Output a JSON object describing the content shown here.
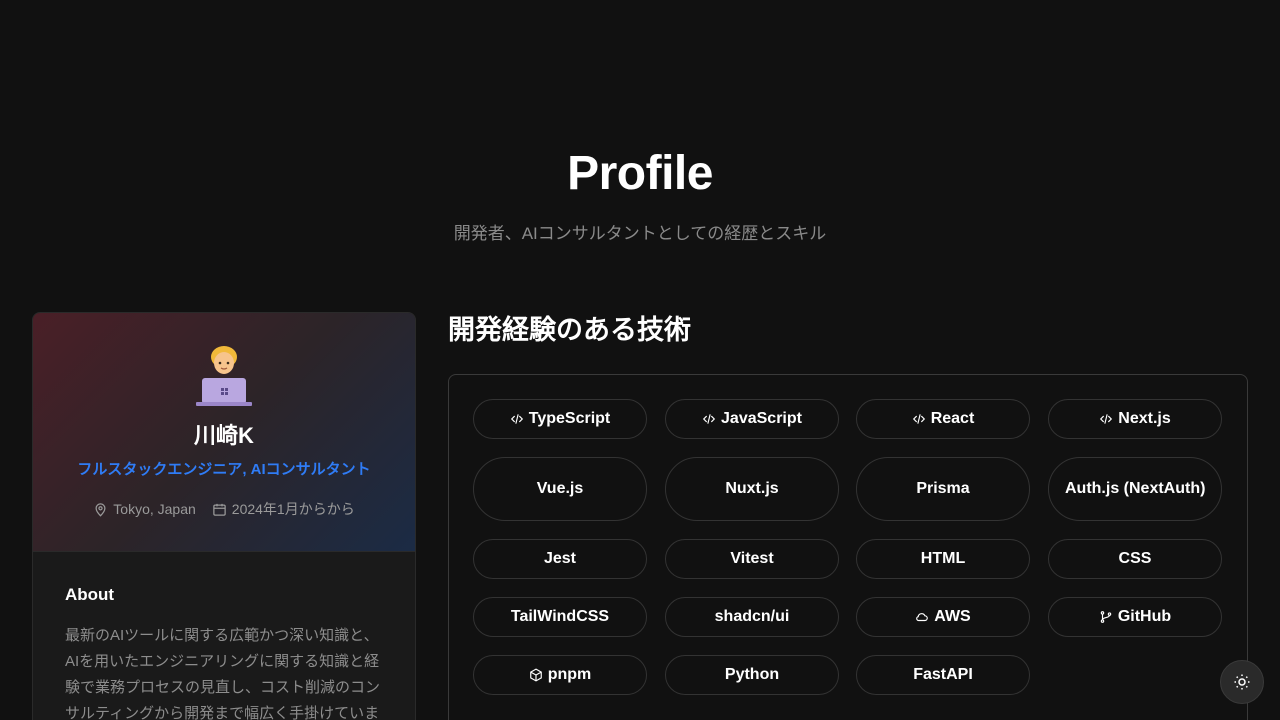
{
  "hero": {
    "title": "Profile",
    "subtitle": "開発者、AIコンサルタントとしての経歴とスキル"
  },
  "profile": {
    "avatar_icon": "technologist-emoji-icon",
    "name": "川崎K",
    "role": "フルスタックエンジニア, AIコンサルタント",
    "location": "Tokyo, Japan",
    "since": "2024年1月からから",
    "about_title": "About",
    "about_text": "最新のAIツールに関する広範かつ深い知識と、AIを用いたエンジニアリングに関する知識と経験で業務プロセスの見直し、コスト削減のコンサルティングから開発まで幅広く手掛けています。迅速な開発が強"
  },
  "tech": {
    "title": "開発経験のある技術",
    "tags": [
      {
        "label": "TypeScript",
        "icon": "code-icon"
      },
      {
        "label": "JavaScript",
        "icon": "code-icon"
      },
      {
        "label": "React",
        "icon": "code-icon"
      },
      {
        "label": "Next.js",
        "icon": "code-icon"
      },
      {
        "label": "Vue.js",
        "icon": ""
      },
      {
        "label": "Nuxt.js",
        "icon": ""
      },
      {
        "label": "Prisma",
        "icon": ""
      },
      {
        "label": "Auth.js (NextAuth)",
        "icon": ""
      },
      {
        "label": "Jest",
        "icon": ""
      },
      {
        "label": "Vitest",
        "icon": ""
      },
      {
        "label": "HTML",
        "icon": ""
      },
      {
        "label": "CSS",
        "icon": ""
      },
      {
        "label": "TailWindCSS",
        "icon": ""
      },
      {
        "label": "shadcn/ui",
        "icon": ""
      },
      {
        "label": "AWS",
        "icon": "cloud-icon"
      },
      {
        "label": "GitHub",
        "icon": "git-branch-icon"
      },
      {
        "label": "pnpm",
        "icon": "package-icon"
      },
      {
        "label": "Python",
        "icon": ""
      },
      {
        "label": "FastAPI",
        "icon": ""
      }
    ]
  },
  "theme_toggle_icon": "sun-icon",
  "colors": {
    "background": "#111111",
    "accent": "#2f7cf6",
    "muted_text": "#8a8a8a"
  }
}
